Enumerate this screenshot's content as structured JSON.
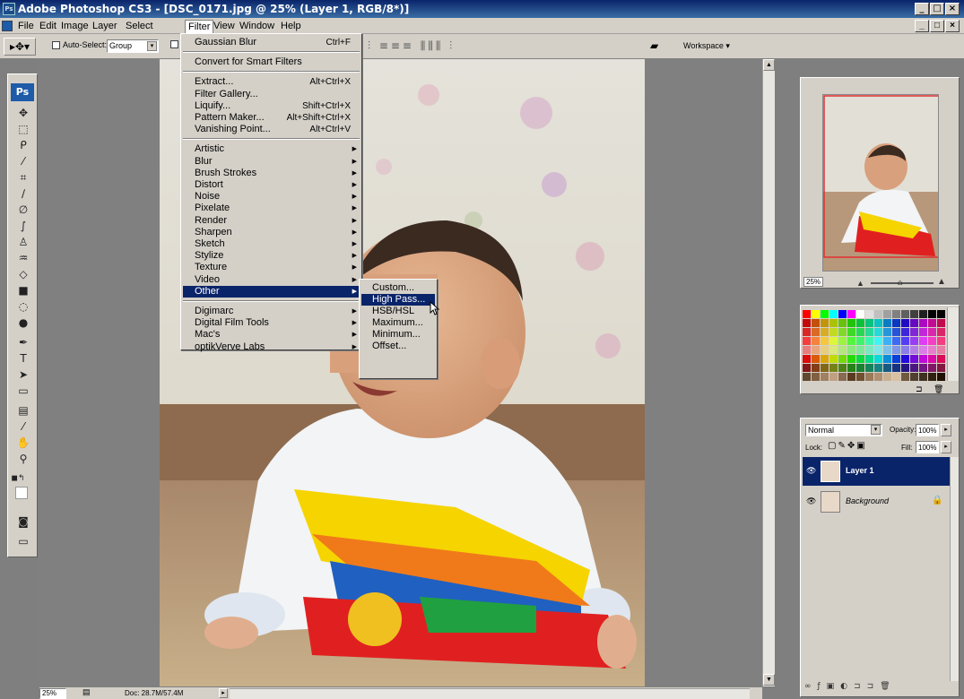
{
  "app": {
    "title": "Adobe Photoshop CS3 - [DSC_0171.jpg @ 25% (Layer 1, RGB/8*)]",
    "min": "_",
    "restore": "□",
    "close": "×"
  },
  "menubar": {
    "items": [
      "File",
      "Edit",
      "Image",
      "Layer",
      "Select",
      "Filter",
      "View",
      "Window",
      "Help"
    ]
  },
  "optionsbar": {
    "auto_select_label": "Auto-Select:",
    "auto_select_value": "Group",
    "workspace_label": "Workspace ▾"
  },
  "toolbox": {
    "logo": "Ps"
  },
  "filter_menu": {
    "items": [
      {
        "label": "Gaussian Blur",
        "shortcut": "Ctrl+F"
      },
      {
        "label": "Convert for Smart Filters",
        "shortcut": ""
      },
      {
        "label": "Extract...",
        "shortcut": "Alt+Ctrl+X"
      },
      {
        "label": "Filter Gallery...",
        "shortcut": ""
      },
      {
        "label": "Liquify...",
        "shortcut": "Shift+Ctrl+X"
      },
      {
        "label": "Pattern Maker...",
        "shortcut": "Alt+Shift+Ctrl+X"
      },
      {
        "label": "Vanishing Point...",
        "shortcut": "Alt+Ctrl+V"
      },
      {
        "label": "Artistic",
        "submenu": true
      },
      {
        "label": "Blur",
        "submenu": true
      },
      {
        "label": "Brush Strokes",
        "submenu": true
      },
      {
        "label": "Distort",
        "submenu": true
      },
      {
        "label": "Noise",
        "submenu": true
      },
      {
        "label": "Pixelate",
        "submenu": true
      },
      {
        "label": "Render",
        "submenu": true
      },
      {
        "label": "Sharpen",
        "submenu": true
      },
      {
        "label": "Sketch",
        "submenu": true
      },
      {
        "label": "Stylize",
        "submenu": true
      },
      {
        "label": "Texture",
        "submenu": true
      },
      {
        "label": "Video",
        "submenu": true
      },
      {
        "label": "Other",
        "submenu": true,
        "highlighted": true
      },
      {
        "label": "Digimarc",
        "submenu": true
      },
      {
        "label": "Digital Film Tools",
        "submenu": true
      },
      {
        "label": "Mac's",
        "submenu": true
      },
      {
        "label": "optikVerve Labs",
        "submenu": true
      }
    ]
  },
  "other_submenu": {
    "items": [
      "Custom...",
      "High Pass...",
      "HSB/HSL",
      "Maximum...",
      "Minimum...",
      "Offset..."
    ],
    "highlighted": "High Pass..."
  },
  "navigator": {
    "zoom": "25%"
  },
  "layers": {
    "blend_mode": "Normal",
    "opacity_label": "Opacity:",
    "opacity": "100%",
    "lock_label": "Lock:",
    "fill_label": "Fill:",
    "fill": "100%",
    "items": [
      {
        "name": "Layer 1",
        "selected": true
      },
      {
        "name": "Background",
        "selected": false
      }
    ]
  },
  "status": {
    "zoom": "25%",
    "doc": "Doc: 28.7M/57.4M"
  },
  "colors": {
    "accent": "#0a246a",
    "panel": "#d4d0c8",
    "canvas": "#7f7f7f"
  }
}
